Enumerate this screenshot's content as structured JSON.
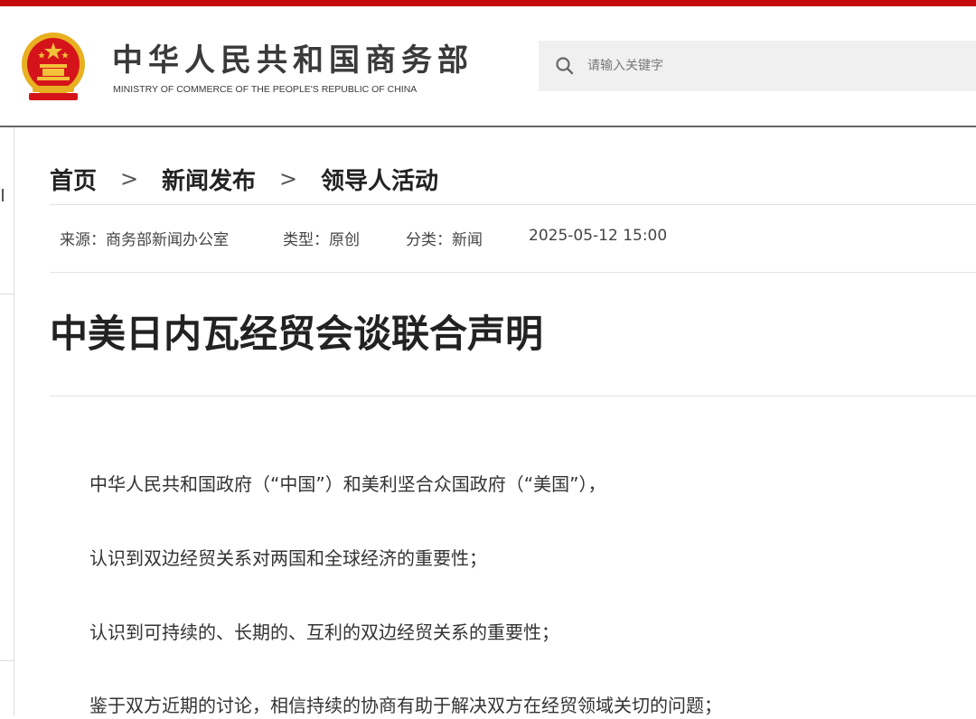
{
  "header": {
    "title": "中华人民共和国商务部",
    "subtitle": "MINISTRY OF COMMERCE OF THE PEOPLE'S REPUBLIC OF CHINA",
    "emblem_icon": "national-emblem-icon",
    "brand_color": "#c40a0a"
  },
  "search": {
    "placeholder": "请输入关键字",
    "icon": "search-icon"
  },
  "breadcrumb": {
    "items": [
      "首页",
      "新闻发布",
      "领导人活动"
    ],
    "separator": ">"
  },
  "meta": {
    "source": "来源：商务部新闻办公室",
    "type": "类型：原创",
    "category": "分类：新闻",
    "datetime": "2025-05-12 15:00"
  },
  "article": {
    "title": "中美日内瓦经贸会谈联合声明",
    "paragraphs": [
      "中华人民共和国政府（“中国”）和美利坚合众国政府（“美国”），",
      "认识到双边经贸关系对两国和全球经济的重要性；",
      "认识到可持续的、长期的、互利的双边经贸关系的重要性；",
      "鉴于双方近期的讨论，相信持续的协商有助于解决双方在经贸领域关切的问题；"
    ]
  }
}
